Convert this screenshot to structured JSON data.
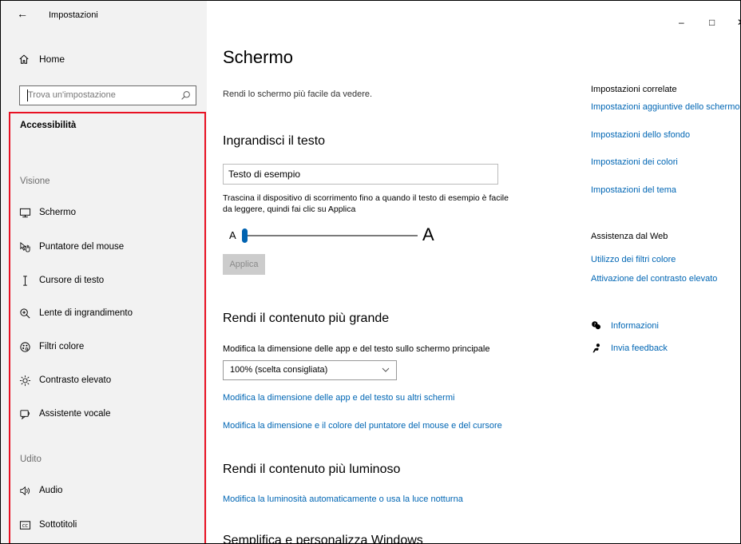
{
  "window": {
    "title": "Impostazioni",
    "controls": {
      "minimize": "–",
      "maximize": "□",
      "close": "✕"
    }
  },
  "sidebar": {
    "home_label": "Home",
    "search_placeholder": "Trova un'impostazione",
    "section_title": "Accessibilità",
    "groups": {
      "vision": "Visione",
      "hearing": "Udito"
    },
    "items": [
      {
        "label": "Schermo",
        "icon": "monitor-icon"
      },
      {
        "label": "Puntatore del mouse",
        "icon": "mouse-pointer-icon"
      },
      {
        "label": "Cursore di testo",
        "icon": "text-cursor-icon"
      },
      {
        "label": "Lente di ingrandimento",
        "icon": "magnifier-icon"
      },
      {
        "label": "Filtri colore",
        "icon": "color-filter-icon"
      },
      {
        "label": "Contrasto elevato",
        "icon": "high-contrast-icon"
      },
      {
        "label": "Assistente vocale",
        "icon": "narrator-icon"
      },
      {
        "label": "Audio",
        "icon": "speaker-icon"
      },
      {
        "label": "Sottotitoli",
        "icon": "captions-icon"
      }
    ]
  },
  "main": {
    "title": "Schermo",
    "description": "Rendi lo schermo più facile da vedere.",
    "text_size": {
      "heading": "Ingrandisci il testo",
      "sample_text": "Testo di esempio",
      "hint": "Trascina il dispositivo di scorrimento fino a quando il testo di esempio è facile da leggere, quindi fai clic su Applica",
      "slider_min_label": "A",
      "slider_max_label": "A",
      "slider_value_fraction": 0.0,
      "apply_label": "Applica"
    },
    "content_size": {
      "heading": "Rendi il contenuto più grande",
      "label": "Modifica la dimensione delle app e del testo sullo schermo principale",
      "selected_option": "100% (scelta consigliata)",
      "link_other_screens": "Modifica la dimensione delle app e del testo su altri schermi",
      "link_pointer": "Modifica la dimensione e il colore del puntatore del mouse e del cursore"
    },
    "brightness": {
      "heading": "Rendi il contenuto più luminoso",
      "link": "Modifica la luminosità automaticamente o usa la luce notturna"
    },
    "next_heading": "Semplifica e personalizza Windows"
  },
  "related": {
    "heading": "Impostazioni correlate",
    "links": [
      "Impostazioni aggiuntive dello schermo",
      "Impostazioni dello sfondo",
      "Impostazioni dei colori",
      "Impostazioni del tema"
    ],
    "web_heading": "Assistenza dal Web",
    "web_links": [
      "Utilizzo dei filtri colore",
      "Attivazione del contrasto elevato"
    ],
    "info_label": "Informazioni",
    "feedback_label": "Invia feedback"
  },
  "colors": {
    "accent": "#0063b1",
    "link": "#0066b4",
    "highlight_border": "#e81123",
    "sidebar_bg": "#f2f2f2"
  }
}
